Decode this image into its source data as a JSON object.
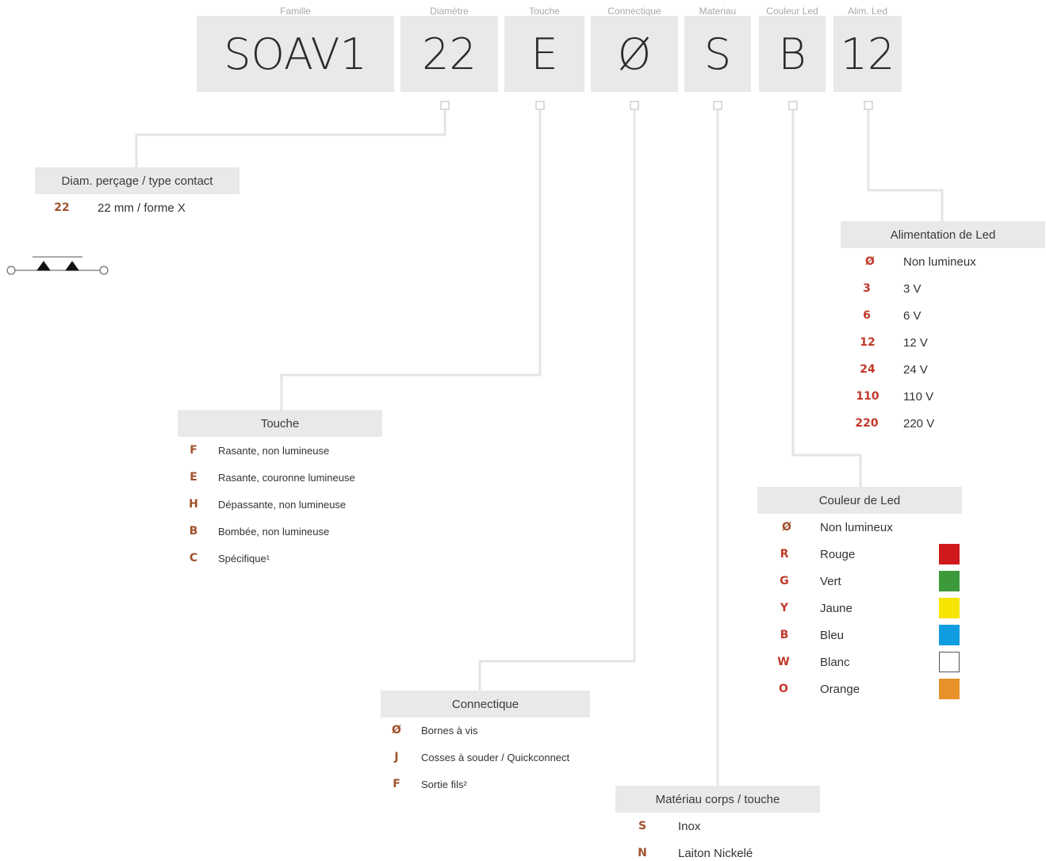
{
  "segments": [
    {
      "label": "Famille",
      "value": "SOAV1"
    },
    {
      "label": "Diamètre",
      "value": "22"
    },
    {
      "label": "Touche",
      "value": "E"
    },
    {
      "label": "Connectique",
      "value": "Ø"
    },
    {
      "label": "Materiau",
      "value": "S"
    },
    {
      "label": "Couleur Led",
      "value": "B"
    },
    {
      "label": "Alim. Led",
      "value": "12"
    }
  ],
  "colors": {
    "code_brown": "#a0522d",
    "code_red": "#c0392b",
    "connector_line": "#e6e6e6",
    "header_bg": "#e9e9e9"
  },
  "diametre": {
    "title": "Diam. perçage / type contact",
    "rows": [
      {
        "code": "22",
        "desc": "22 mm / forme X"
      }
    ],
    "symbol": "contact-symbol-icon"
  },
  "alimentation": {
    "title": "Alimentation de Led",
    "rows": [
      {
        "code": "Ø",
        "desc": "Non lumineux"
      },
      {
        "code": "3",
        "desc": "3 V"
      },
      {
        "code": "6",
        "desc": "6 V"
      },
      {
        "code": "12",
        "desc": "12 V"
      },
      {
        "code": "24",
        "desc": "24 V"
      },
      {
        "code": "110",
        "desc": "110 V"
      },
      {
        "code": "220",
        "desc": "220 V"
      }
    ]
  },
  "touche": {
    "title": "Touche",
    "rows": [
      {
        "code": "F",
        "desc": "Rasante, non lumineuse"
      },
      {
        "code": "E",
        "desc": "Rasante, couronne lumineuse"
      },
      {
        "code": "H",
        "desc": "Dépassante, non lumineuse"
      },
      {
        "code": "B",
        "desc": "Bombée, non lumineuse"
      },
      {
        "code": "C",
        "desc": "Spécifique¹"
      }
    ]
  },
  "couleur": {
    "title": "Couleur de Led",
    "rows": [
      {
        "code": "Ø",
        "desc": "Non lumineux",
        "swatch": ""
      },
      {
        "code": "R",
        "desc": "Rouge",
        "swatch": "#d0191c"
      },
      {
        "code": "G",
        "desc": "Vert",
        "swatch": "#3c9a3a"
      },
      {
        "code": "Y",
        "desc": "Jaune",
        "swatch": "#f7e400"
      },
      {
        "code": "B",
        "desc": "Bleu",
        "swatch": "#0f9ce0"
      },
      {
        "code": "W",
        "desc": "Blanc",
        "swatch": "#ffffff"
      },
      {
        "code": "O",
        "desc": "Orange",
        "swatch": "#e8902a"
      }
    ]
  },
  "connectique": {
    "title": "Connectique",
    "rows": [
      {
        "code": "Ø",
        "desc": "Bornes à vis"
      },
      {
        "code": "J",
        "desc": "Cosses à souder / Quickconnect"
      },
      {
        "code": "F",
        "desc": "Sortie fils²"
      }
    ]
  },
  "materiau": {
    "title": "Matériau corps / touche",
    "rows": [
      {
        "code": "S",
        "desc": "Inox"
      },
      {
        "code": "N",
        "desc": "Laiton Nickelé"
      }
    ]
  }
}
